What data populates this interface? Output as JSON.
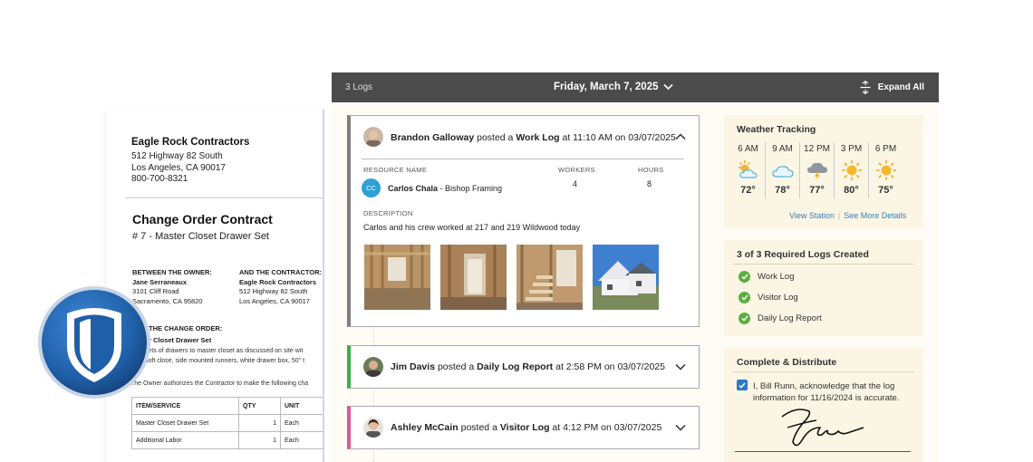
{
  "document": {
    "company": "Eagle Rock Contractors",
    "address_lines": [
      "512 Highway 82 South",
      "Los Angeles, CA 90017",
      "800-700-8321"
    ],
    "title": "Change Order Contract",
    "subtitle": "# 7 - Master Closet Drawer Set",
    "owner": {
      "heading": "BETWEEN THE OWNER:",
      "name": "Jane Serraneaux",
      "line1": "3101 Cliff Road",
      "line2": "Sacramento, CA 95820"
    },
    "contractor": {
      "heading": "AND THE CONTRACTOR:",
      "name": "Eagle Rock Contractors",
      "line1": "512 Highway 82 South",
      "line2": "Los Angeles, CA 90017"
    },
    "change_order_heading": "THE CHANGE ORDER:",
    "change_order_subtitle": "r Closet Drawer Set",
    "change_order_body": [
      "sets of drawers to master closet as discussed on site wit",
      "soft close, side mounted runners, white drawer box, 50\" t"
    ],
    "authorization_text": "The Owner authorizes the Contractor to make the following cha",
    "table": {
      "headers": [
        "ITEM/SERVICE",
        "QTY",
        "UNIT"
      ],
      "rows": [
        {
          "item": "Master Closet Drawer Set",
          "qty": "1",
          "unit": "Each"
        },
        {
          "item": "Additional Labor",
          "qty": "1",
          "unit": "Each"
        }
      ]
    }
  },
  "topbar": {
    "logs_count": "3 Logs",
    "date": "Friday, March 7, 2025",
    "expand_label": "Expand All"
  },
  "logs": [
    {
      "author": "Brandon Galloway",
      "verb": "posted a",
      "type": "Work Log",
      "at": "at",
      "time": "11:10 AM",
      "on": "on",
      "date": "03/07/2025",
      "expanded": true,
      "resource_label": "RESOURCE NAME",
      "workers_label": "WORKERS",
      "hours_label": "HOURS",
      "resource_initials": "CC",
      "resource_name": "Carlos Chala",
      "resource_company": " - Bishop Framing",
      "workers": "4",
      "hours": "8",
      "description_label": "DESCRIPTION",
      "description": "Carlos and his crew worked at 217 and 219 Wildwood today"
    },
    {
      "author": "Jim Davis",
      "verb": "posted a",
      "type": "Daily Log Report",
      "at": "at",
      "time": "2:58 PM",
      "on": "on",
      "date": "03/07/2025",
      "expanded": false
    },
    {
      "author": "Ashley McCain",
      "verb": "posted a",
      "type": "Visitor Log",
      "at": "at",
      "time": "4:12 PM",
      "on": "on",
      "date": "03/07/2025",
      "expanded": false
    }
  ],
  "weather": {
    "title": "Weather Tracking",
    "hours": [
      {
        "time": "6 AM",
        "temp": "72°",
        "icon": "partly-sunny-icon"
      },
      {
        "time": "9 AM",
        "temp": "78°",
        "icon": "cloud-icon"
      },
      {
        "time": "12 PM",
        "temp": "77°",
        "icon": "storm-icon"
      },
      {
        "time": "3 PM",
        "temp": "80°",
        "icon": "sun-icon"
      },
      {
        "time": "6 PM",
        "temp": "75°",
        "icon": "sun-icon"
      }
    ],
    "view_station": "View Station",
    "see_more": "See More Details"
  },
  "required_logs": {
    "title": "3 of 3 Required Logs Created",
    "items": [
      "Work Log",
      "Visitor Log",
      "Daily Log Report"
    ]
  },
  "distribute": {
    "title": "Complete & Distribute",
    "acknowledgement": "I, Bill Runn, acknowledge that the log information for 11/16/2024 is accurate.",
    "checked": true
  },
  "colors": {
    "topbar": "#4b4b4b",
    "panel": "#fbf6e4",
    "work_log_accent": "#7f7f7f",
    "daily_report_accent": "#36b24a",
    "visitor_log_accent": "#e0569a",
    "check_green": "#5ab03f",
    "link_blue": "#3a7bb8",
    "logo_blue": "#1f5fa8"
  }
}
